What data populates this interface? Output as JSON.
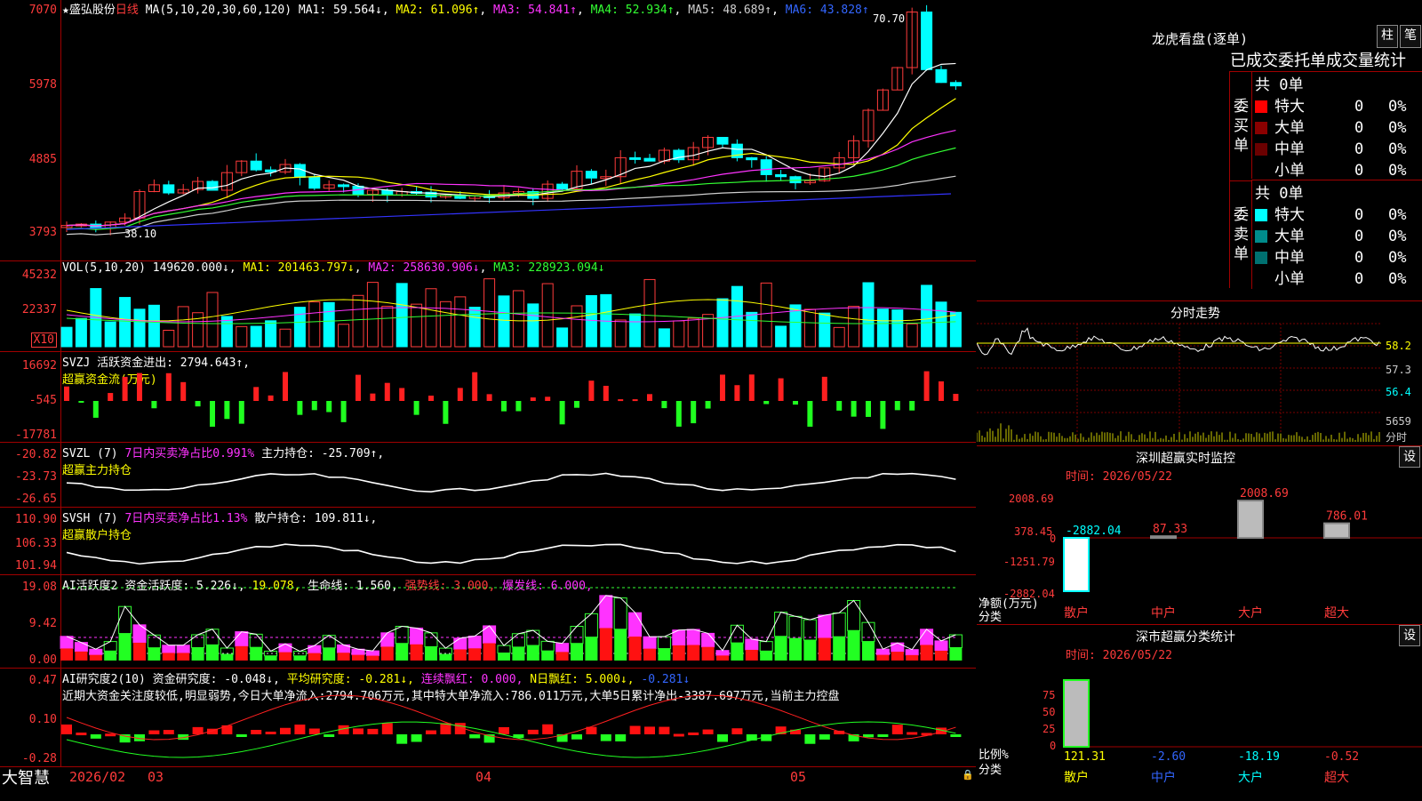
{
  "stock": {
    "name": "盛弘股份",
    "period": "日线",
    "star": "★"
  },
  "main_pane": {
    "ma_label": "MA(5,10,20,30,60,120)",
    "ma1": "MA1: 59.564↓",
    "ma2": "MA2: 61.096↑",
    "ma3": "MA3: 54.841↑",
    "ma4": "MA4: 52.934↑",
    "ma5": "MA5: 48.689↑",
    "ma6": "MA6: 43.828↑",
    "y_labels": [
      "7070",
      "5978",
      "4885",
      "3793"
    ],
    "high_mark": "70.70",
    "low_mark": "38.10"
  },
  "vol_pane": {
    "label": "VOL(5,10,20)",
    "value": "149620.000↓",
    "ma1": "MA1: 201463.797↓",
    "ma2": "MA2: 258630.906↓",
    "ma3": "MA3: 228923.094↓",
    "y_labels": [
      "45232",
      "22337"
    ],
    "unit": "X10"
  },
  "svzj_pane": {
    "label": "SVZJ",
    "desc": "活跃资金进出: 2794.643↑,",
    "sub": "超赢资金流(万元)",
    "y_labels": [
      "16692",
      "-545",
      "-17781"
    ]
  },
  "svzl_pane": {
    "label": "SVZL (7)",
    "desc": "7日内买卖净占比0.991%",
    "main": "主力持仓: -25.709↑,",
    "sub": "超赢主力持仓",
    "y_labels": [
      "-20.82",
      "-23.73",
      "-26.65"
    ]
  },
  "svsh_pane": {
    "label": "SVSH (7)",
    "desc": "7日内买卖净占比1.13%",
    "main": "散户持仓: 109.811↓,",
    "sub": "超赢散户持仓",
    "y_labels": [
      "110.90",
      "106.33",
      "101.94"
    ]
  },
  "ai2_pane": {
    "label": "AI活跃度2",
    "act": "资金活跃度: 5.226↓,",
    "v2": "19.078,",
    "life": "生命线: 1.560,",
    "strong": "强势线: 3.000,",
    "burst": "爆发线: 6.000,",
    "y_labels": [
      "19.08",
      "9.42",
      "0.00"
    ]
  },
  "research_pane": {
    "label": "AI研究度2(10)",
    "res": "资金研究度: -0.048↓,",
    "avg": "平均研究度: -0.281↓,",
    "cont": "连续飘红: 0.000,",
    "nday": "N日飘红: 5.000↓,",
    "last": "-0.281↓",
    "text": "近期大资金关注度较低,明显弱势,今日大单净流入:2794.706万元,其中特大单净流入:786.011万元,大单5日累计净出-3387.697万元,当前主力控盘",
    "y_labels": [
      "0.47",
      "0.10",
      "-0.28"
    ]
  },
  "date_axis": {
    "brand": "大智慧",
    "labels": [
      "2026/02",
      "03",
      "04",
      "05"
    ]
  },
  "dragon_tiger": {
    "title": "龙虎看盘(逐单)",
    "btn_col": "柱",
    "btn_pen": "笔",
    "header": "已成交委托单成交量统计",
    "buy_label": "委买单",
    "sell_label": "委卖单",
    "buy_total": "共 0单",
    "sell_total": "共 0单",
    "buy_rows": [
      {
        "name": "特大",
        "count": "0",
        "pct": "0%",
        "color": "#ff0000"
      },
      {
        "name": "大单",
        "count": "0",
        "pct": "0%",
        "color": "#8b0000"
      },
      {
        "name": "中单",
        "count": "0",
        "pct": "0%",
        "color": "#6b0000"
      },
      {
        "name": "小单",
        "count": "0",
        "pct": "0%",
        "color": "#000000"
      }
    ],
    "sell_rows": [
      {
        "name": "特大",
        "count": "0",
        "pct": "0%",
        "color": "#00ffff"
      },
      {
        "name": "大单",
        "count": "0",
        "pct": "0%",
        "color": "#008b8b"
      },
      {
        "name": "中单",
        "count": "0",
        "pct": "0%",
        "color": "#007070"
      },
      {
        "name": "小单",
        "count": "0",
        "pct": "0%",
        "color": "#000000"
      }
    ]
  },
  "minute_chart": {
    "title": "分时走势",
    "y_labels": [
      "58.2",
      "57.3",
      "56.4",
      "5659"
    ],
    "unit": "分时"
  },
  "sz_monitor": {
    "title": "深圳超赢实时监控",
    "btn": "设",
    "time": "时间: 2026/05/22",
    "y_labels": [
      "2008.69",
      "378.45",
      "0",
      "-1251.79",
      "-2882.04"
    ],
    "y_unit": "净额(万元)",
    "x_unit": "分类",
    "categories": [
      "散户",
      "中户",
      "大户",
      "超大"
    ],
    "values": [
      -2882.04,
      87.33,
      2008.69,
      786.01
    ],
    "value_labels": [
      "-2882.04",
      "87.33",
      "2008.69",
      "786.01"
    ]
  },
  "sz_class": {
    "title": "深市超赢分类统计",
    "btn": "设",
    "time": "时间: 2026/05/22",
    "y_labels": [
      "75",
      "50",
      "25",
      "0"
    ],
    "y_unit": "比例%",
    "x_unit": "分类",
    "categories": [
      "散户",
      "中户",
      "大户",
      "超大"
    ],
    "values": [
      121.31,
      -2.6,
      -18.19,
      -0.52
    ],
    "value_labels": [
      "121.31",
      "-2.60",
      "-18.19",
      "-0.52"
    ]
  }
}
